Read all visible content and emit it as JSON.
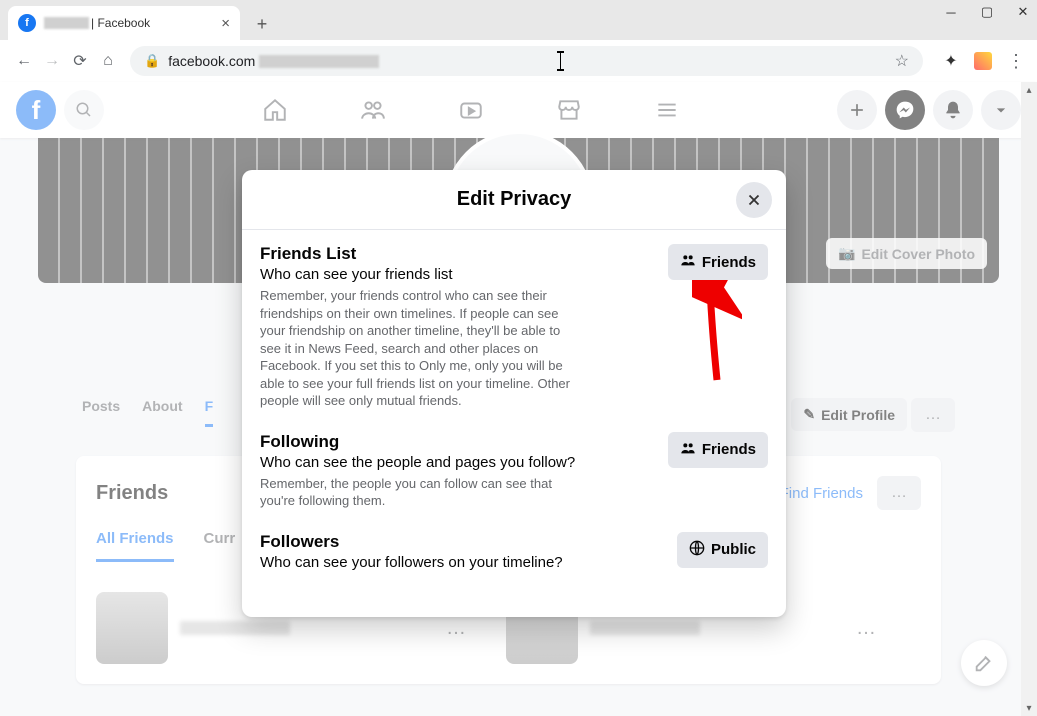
{
  "browser": {
    "tab_suffix": " | Facebook",
    "url_host": "facebook.com"
  },
  "fb": {
    "edit_cover": "Edit Cover Photo",
    "edit_profile": "Edit Profile",
    "profile_tabs": {
      "posts": "Posts",
      "about": "About"
    },
    "friends_card": {
      "title": "Friends",
      "find": "Find Friends",
      "all": "All Friends",
      "curr": "Curr"
    }
  },
  "modal": {
    "title": "Edit Privacy",
    "sections": [
      {
        "title": "Friends List",
        "subtitle": "Who can see your friends list",
        "desc": "Remember, your friends control who can see their friendships on their own timelines. If people can see your friendship on another timeline, they'll be able to see it in News Feed, search and other places on Facebook. If you set this to Only me, only you will be able to see your full friends list on your timeline. Other people will see only mutual friends.",
        "button": "Friends",
        "icon": "friends"
      },
      {
        "title": "Following",
        "subtitle": "Who can see the people and pages you follow?",
        "desc": "Remember, the people you can follow can see that you're following them.",
        "button": "Friends",
        "icon": "friends"
      },
      {
        "title": "Followers",
        "subtitle": "Who can see your followers on your timeline?",
        "desc": "",
        "button": "Public",
        "icon": "globe"
      }
    ]
  }
}
